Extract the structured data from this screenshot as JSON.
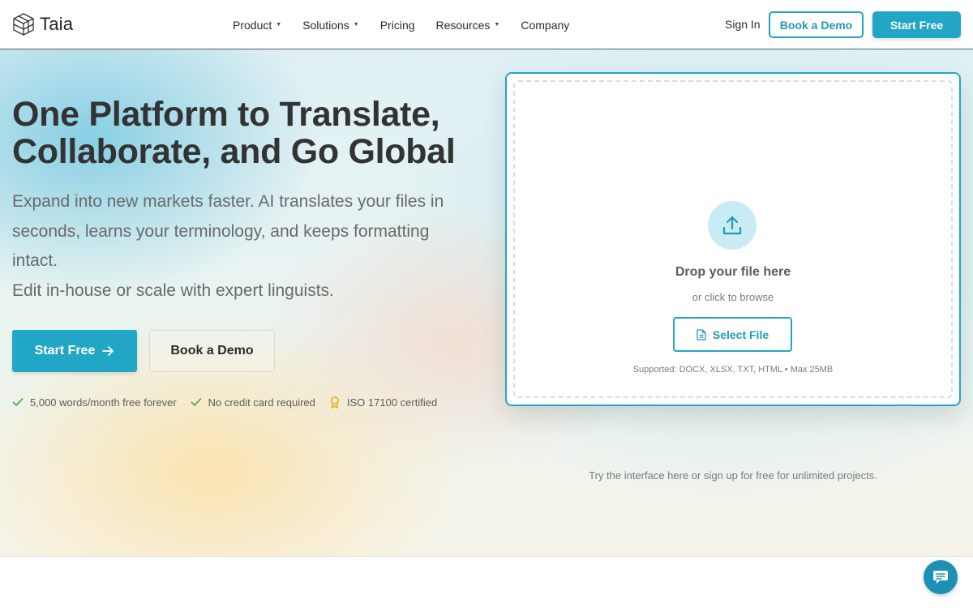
{
  "nav": {
    "logo_text": "Taia",
    "menu": [
      {
        "label": "Product",
        "has_caret": true
      },
      {
        "label": "Solutions",
        "has_caret": true
      },
      {
        "label": "Pricing",
        "has_caret": false
      },
      {
        "label": "Resources",
        "has_caret": true
      },
      {
        "label": "Company",
        "has_caret": false
      }
    ],
    "sign_in": "Sign In",
    "book_demo": "Book a Demo",
    "start_free": "Start Free"
  },
  "hero": {
    "headline_line1": "One Platform to Translate,",
    "headline_line2": "Collaborate, and Go Global",
    "subtext_line1": "Expand into new markets faster. AI translates your files in seconds, learns your terminology, and keeps formatting intact.",
    "subtext_line2": "Edit in-house or scale with expert linguists.",
    "start_free": "Start Free",
    "book_demo": "Book a Demo",
    "features": [
      {
        "icon": "check-icon",
        "text": "5,000 words/month free forever"
      },
      {
        "icon": "check-icon",
        "text": "No credit card required"
      },
      {
        "icon": "award-icon",
        "text": "ISO 17100 certified"
      }
    ]
  },
  "upload": {
    "title": "Drop your file here",
    "subtitle": "or click to browse",
    "select_button": "Select File",
    "supported": "Supported: DOCX, XLSX, TXT, HTML • Max 25MB",
    "try_text": "Try the interface here or sign up for free for unlimited projects."
  },
  "colors": {
    "accent": "#22a6c6",
    "accent_text": "#1f9bb9",
    "check_green": "#4cae4f",
    "award_gold": "#e8b020",
    "chat_blue": "#1e8fb5"
  }
}
